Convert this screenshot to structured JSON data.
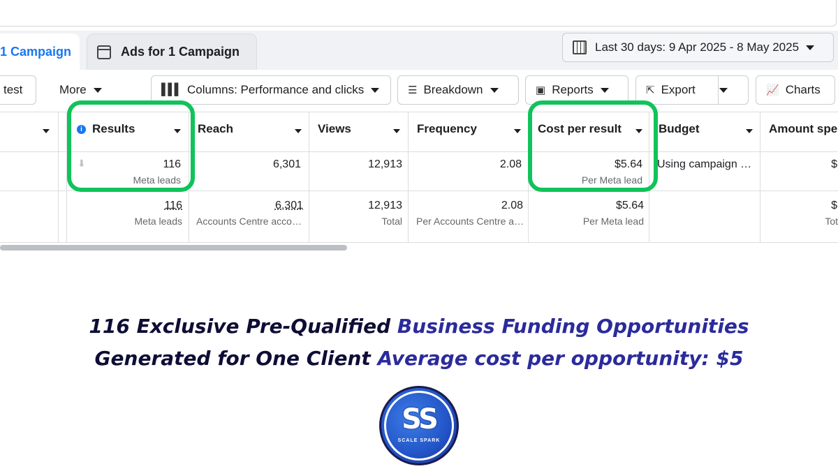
{
  "tabs": [
    {
      "label": "1 Campaign",
      "active": true
    },
    {
      "label": "Ads for 1 Campaign",
      "active": false
    }
  ],
  "date_range": "Last 30 days: 9 Apr 2025 - 8 May 2025",
  "toolbar": {
    "test": "test",
    "more": "More",
    "columns": "Columns: Performance and clicks",
    "breakdown": "Breakdown",
    "reports": "Reports",
    "export": "Export",
    "charts": "Charts"
  },
  "table": {
    "headers": [
      "Results",
      "Reach",
      "Views",
      "Frequency",
      "Cost per result",
      "Budget",
      "Amount spent"
    ],
    "row1": {
      "results": "116",
      "results_sub": "Meta leads",
      "reach": "6,301",
      "views": "12,913",
      "frequency": "2.08",
      "cost": "$5.64",
      "cost_sub": "Per Meta lead",
      "budget": "Using campaign …",
      "amount": "$"
    },
    "row2": {
      "results": "116",
      "results_sub": "Meta leads",
      "reach": "6,301",
      "reach_sub": "Accounts Centre acco…",
      "views": "12,913",
      "views_sub": "Total",
      "frequency": "2.08",
      "frequency_sub": "Per Accounts Centre a…",
      "cost": "$5.64",
      "cost_sub": "Per Meta lead",
      "amount": "$",
      "amount_sub": "Tot"
    }
  },
  "headline": {
    "line1_dark": "116 Exclusive Pre-Qualified",
    "line1_blue": "Business Funding Opportunities",
    "line2_dark": "Generated for One Client",
    "line2_blue": "Average cost per opportunity: $5"
  },
  "logo": {
    "letters": "SS",
    "brand": "SCALE SPARK"
  },
  "colors": {
    "highlight": "#10c35a",
    "accent": "#1877f2",
    "headline_dark": "#0d0d35",
    "headline_blue": "#2b2b9c"
  }
}
